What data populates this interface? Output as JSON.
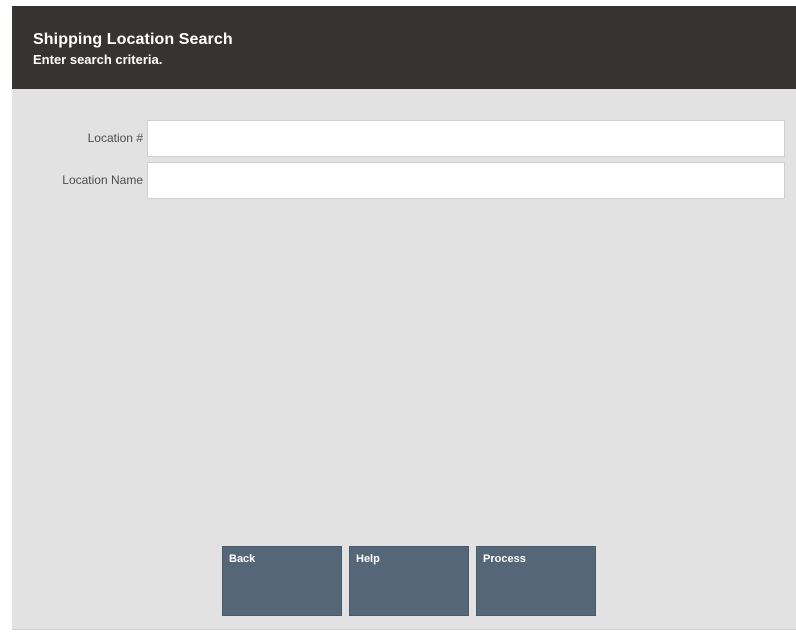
{
  "header": {
    "title": "Shipping Location Search",
    "subtitle": "Enter search criteria."
  },
  "form": {
    "location_number": {
      "label": "Location #",
      "value": ""
    },
    "location_name": {
      "label": "Location Name",
      "value": ""
    }
  },
  "buttons": {
    "back": "Back",
    "help": "Help",
    "process": "Process"
  },
  "colors": {
    "header_bg": "#363431",
    "screen_bg": "#e2e2e2",
    "button_bg": "#556679"
  }
}
